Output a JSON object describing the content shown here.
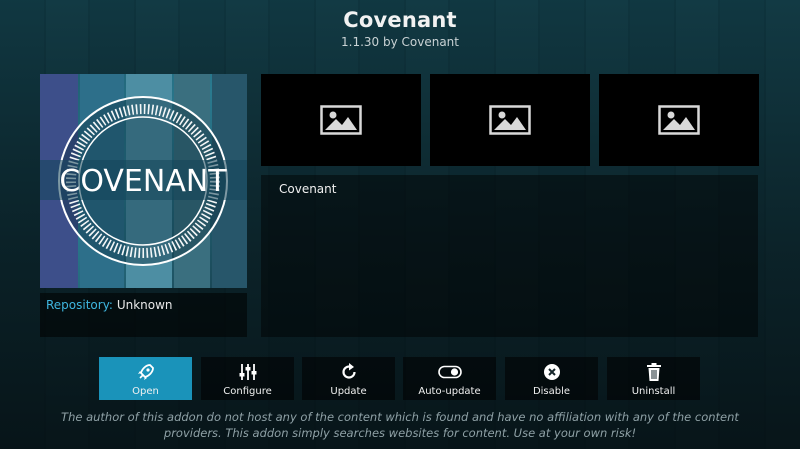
{
  "header": {
    "title": "Covenant",
    "subtitle": "1.1.30 by Covenant"
  },
  "fanart": {
    "logo_text": "COVENANT"
  },
  "info": {
    "repository_label": "Repository:",
    "repository_value": "Unknown"
  },
  "screenshots": [
    {
      "icon": "image-icon"
    },
    {
      "icon": "image-icon"
    },
    {
      "icon": "image-icon"
    }
  ],
  "description": {
    "text": "Covenant"
  },
  "buttons": [
    {
      "label": "Open",
      "icon": "rocket-icon",
      "active": true
    },
    {
      "label": "Configure",
      "icon": "sliders-icon",
      "active": false
    },
    {
      "label": "Update",
      "icon": "refresh-icon",
      "active": false
    },
    {
      "label": "Auto-update",
      "icon": "toggle-icon",
      "active": false
    },
    {
      "label": "Disable",
      "icon": "close-circle-icon",
      "active": false
    },
    {
      "label": "Uninstall",
      "icon": "trash-icon",
      "active": false
    }
  ],
  "disclaimer": {
    "line1": "The author of this addon do not host any of the content which is found and have no affiliation with any of the content",
    "line2": "providers. This addon simply searches websites for content. Use at your own risk!"
  },
  "colors": {
    "accent": "#1a93ba",
    "repository_key": "#3fb6e0",
    "disclaimer": "#8fa1a6"
  }
}
